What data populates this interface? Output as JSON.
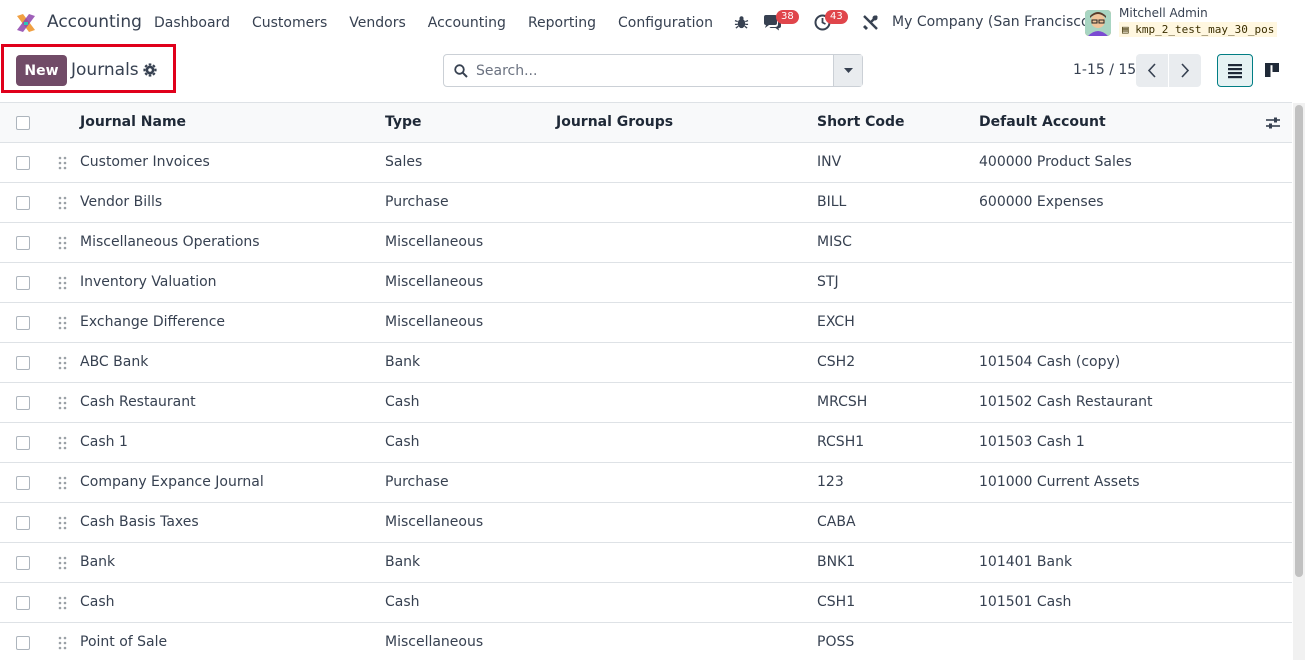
{
  "app": {
    "name": "Accounting",
    "brand_color": "#714b67",
    "menu": [
      "Dashboard",
      "Customers",
      "Vendors",
      "Accounting",
      "Reporting",
      "Configuration"
    ]
  },
  "systray": {
    "messages_count": "38",
    "activities_count": "43",
    "company": "My Company (San Francisco)",
    "user_name": "Mitchell Admin",
    "database": "kmp_2_test_may_30_pos"
  },
  "control_panel": {
    "new_label": "New",
    "breadcrumb": "Journals",
    "search_placeholder": "Search...",
    "pager": "1-15 / 15"
  },
  "table": {
    "columns": {
      "name": "Journal Name",
      "type": "Type",
      "groups": "Journal Groups",
      "code": "Short Code",
      "account": "Default Account"
    },
    "rows": [
      {
        "name": "Customer Invoices",
        "type": "Sales",
        "groups": "",
        "code": "INV",
        "account": "400000 Product Sales"
      },
      {
        "name": "Vendor Bills",
        "type": "Purchase",
        "groups": "",
        "code": "BILL",
        "account": "600000 Expenses"
      },
      {
        "name": "Miscellaneous Operations",
        "type": "Miscellaneous",
        "groups": "",
        "code": "MISC",
        "account": ""
      },
      {
        "name": "Inventory Valuation",
        "type": "Miscellaneous",
        "groups": "",
        "code": "STJ",
        "account": ""
      },
      {
        "name": "Exchange Difference",
        "type": "Miscellaneous",
        "groups": "",
        "code": "EXCH",
        "account": ""
      },
      {
        "name": "ABC Bank",
        "type": "Bank",
        "groups": "",
        "code": "CSH2",
        "account": "101504 Cash (copy)"
      },
      {
        "name": "Cash Restaurant",
        "type": "Cash",
        "groups": "",
        "code": "MRCSH",
        "account": "101502 Cash Restaurant"
      },
      {
        "name": "Cash 1",
        "type": "Cash",
        "groups": "",
        "code": "RCSH1",
        "account": "101503 Cash 1"
      },
      {
        "name": "Company Expance Journal",
        "type": "Purchase",
        "groups": "",
        "code": "123",
        "account": "101000 Current Assets"
      },
      {
        "name": "Cash Basis Taxes",
        "type": "Miscellaneous",
        "groups": "",
        "code": "CABA",
        "account": ""
      },
      {
        "name": "Bank",
        "type": "Bank",
        "groups": "",
        "code": "BNK1",
        "account": "101401 Bank"
      },
      {
        "name": "Cash",
        "type": "Cash",
        "groups": "",
        "code": "CSH1",
        "account": "101501 Cash"
      },
      {
        "name": "Point of Sale",
        "type": "Miscellaneous",
        "groups": "",
        "code": "POSS",
        "account": ""
      }
    ]
  }
}
